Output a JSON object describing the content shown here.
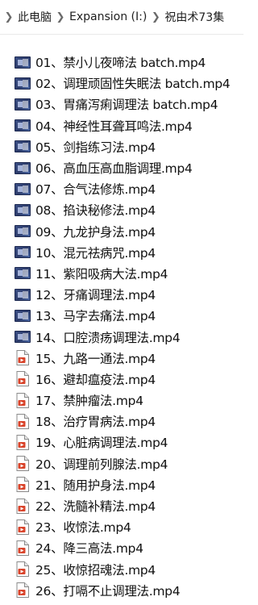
{
  "breadcrumb": {
    "items": [
      "此电脑",
      "Expansion (I:)",
      "祝由术73集"
    ]
  },
  "files": [
    {
      "name": "01、禁小儿夜啼法 batch.mp4",
      "icon": "video-file-icon"
    },
    {
      "name": "02、调理顽固性失眠法 batch.mp4",
      "icon": "video-file-icon"
    },
    {
      "name": "03、胃痛泻痢调理法 batch.mp4",
      "icon": "video-file-icon"
    },
    {
      "name": "04、神经性耳聋耳鸣法.mp4",
      "icon": "video-file-icon"
    },
    {
      "name": "05、剑指练习法.mp4",
      "icon": "video-file-icon"
    },
    {
      "name": "06、高血压高血脂调理.mp4",
      "icon": "video-file-icon"
    },
    {
      "name": "07、合气法修炼.mp4",
      "icon": "video-file-icon"
    },
    {
      "name": "08、掐诀秘修法.mp4",
      "icon": "video-file-icon"
    },
    {
      "name": "09、九龙护身法.mp4",
      "icon": "video-file-icon"
    },
    {
      "name": "10、混元祛病咒.mp4",
      "icon": "video-file-icon"
    },
    {
      "name": "11、紫阳吸病大法.mp4",
      "icon": "video-file-icon"
    },
    {
      "name": "12、牙痛调理法.mp4",
      "icon": "video-file-icon"
    },
    {
      "name": "13、马字去痛法.mp4",
      "icon": "video-file-icon"
    },
    {
      "name": "14、口腔溃疡调理法.mp4",
      "icon": "video-file-icon"
    },
    {
      "name": "15、九路一通法.mp4",
      "icon": "media-file-icon"
    },
    {
      "name": "16、避却瘟疫法.mp4",
      "icon": "media-file-icon"
    },
    {
      "name": "17、禁肿瘤法.mp4",
      "icon": "media-file-icon"
    },
    {
      "name": "18、治疗胃病法.mp4",
      "icon": "media-file-icon"
    },
    {
      "name": "19、心脏病调理法.mp4",
      "icon": "media-file-icon"
    },
    {
      "name": "20、调理前列腺法.mp4",
      "icon": "media-file-icon"
    },
    {
      "name": "21、随用护身法.mp4",
      "icon": "media-file-icon"
    },
    {
      "name": "22、洗髓补精法.mp4",
      "icon": "media-file-icon"
    },
    {
      "name": "23、收惊法.mp4",
      "icon": "media-file-icon"
    },
    {
      "name": "24、降三高法.mp4",
      "icon": "media-file-icon"
    },
    {
      "name": "25、收惊招魂法.mp4",
      "icon": "media-file-icon"
    },
    {
      "name": "26、打嗝不止调理法.mp4",
      "icon": "media-file-icon"
    }
  ]
}
